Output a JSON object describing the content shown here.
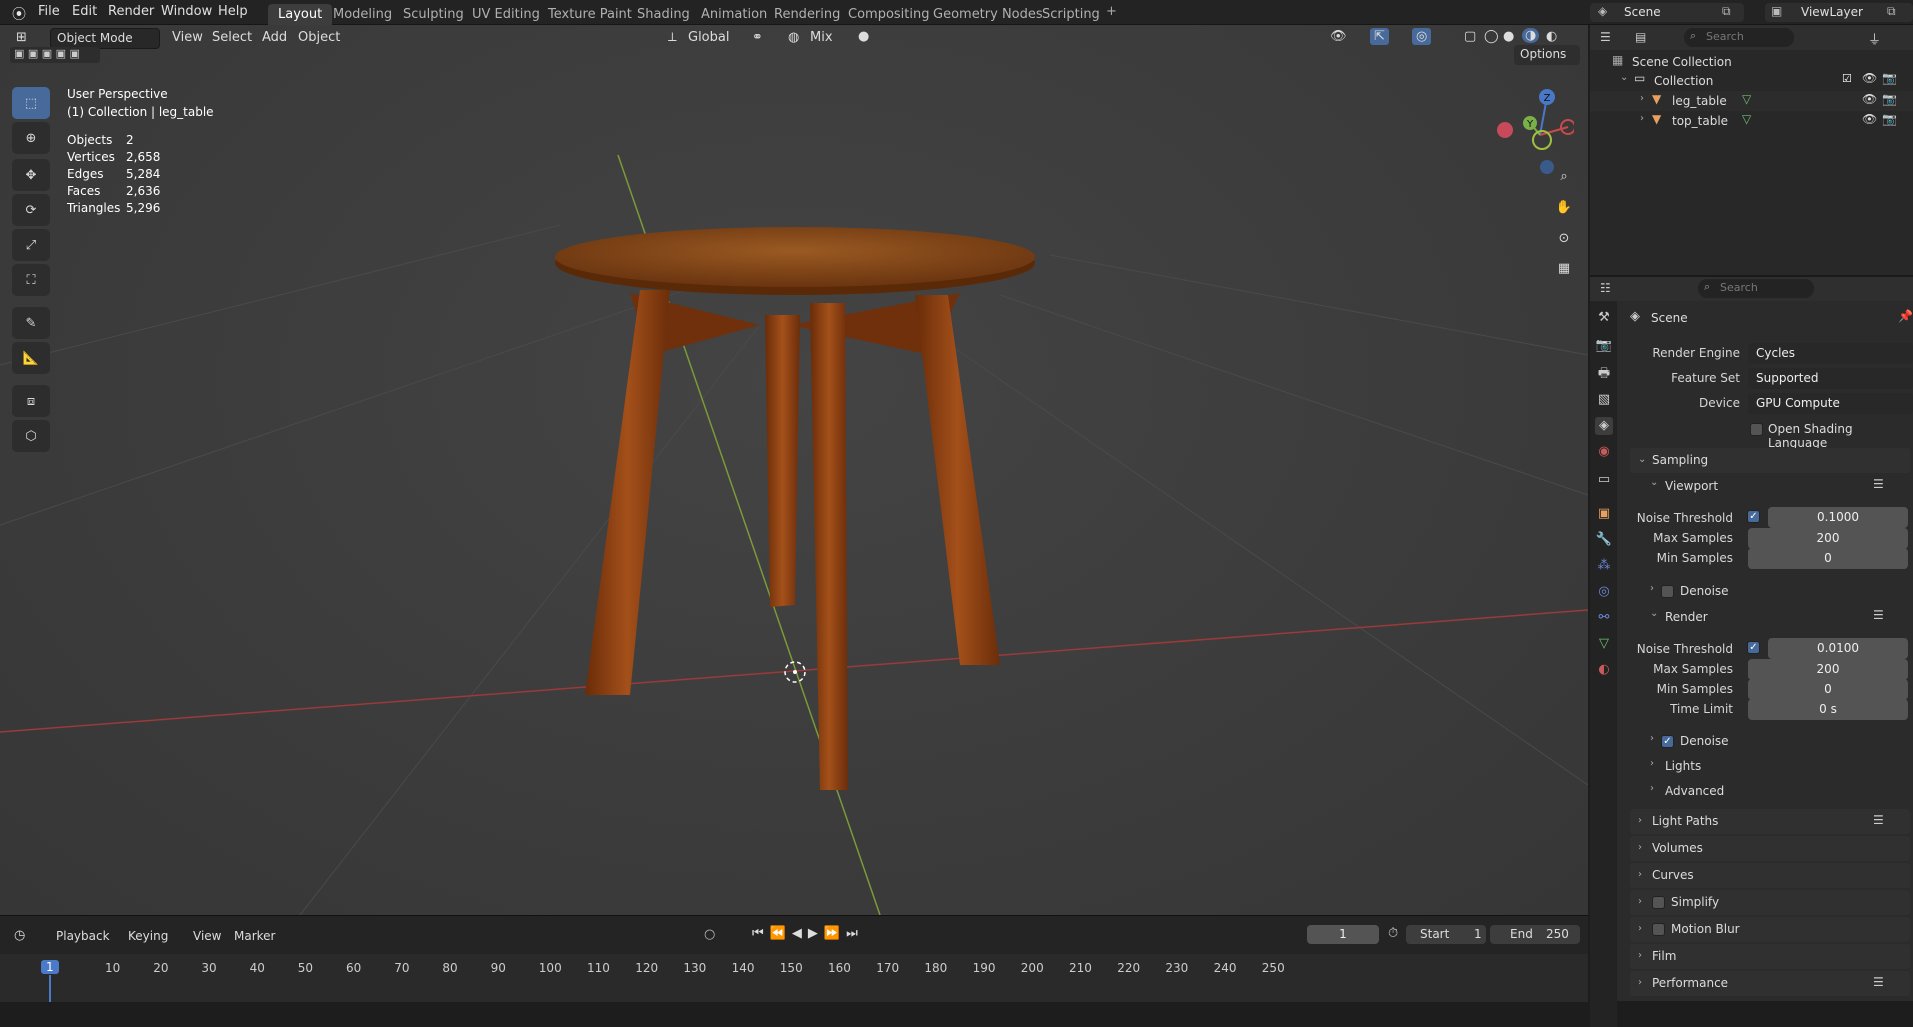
{
  "topbar": {
    "menus": [
      "File",
      "Edit",
      "Render",
      "Window",
      "Help"
    ],
    "workspaces": [
      "Layout",
      "Modeling",
      "Sculpting",
      "UV Editing",
      "Texture Paint",
      "Shading",
      "Animation",
      "Rendering",
      "Compositing",
      "Geometry Nodes",
      "Scripting"
    ],
    "add_tab": "+",
    "scene": "Scene",
    "view_layer": "ViewLayer"
  },
  "viewport_header": {
    "mode": "Object Mode",
    "menus": [
      "View",
      "Select",
      "Add",
      "Object"
    ],
    "orientation": "Global",
    "blend": "Mix",
    "options": "Options"
  },
  "overlay": {
    "title": "User Perspective",
    "subtitle": "(1) Collection | leg_table",
    "stats": [
      {
        "label": "Objects",
        "value": "2"
      },
      {
        "label": "Vertices",
        "value": "2,658"
      },
      {
        "label": "Edges",
        "value": "5,284"
      },
      {
        "label": "Faces",
        "value": "2,636"
      },
      {
        "label": "Triangles",
        "value": "5,296"
      }
    ]
  },
  "gizmo": {
    "z": "Z",
    "y": "Y"
  },
  "outliner": {
    "search_placeholder": "Search",
    "root": "Scene Collection",
    "collection": "Collection",
    "objects": [
      "leg_table",
      "top_table"
    ]
  },
  "properties": {
    "search_placeholder": "Search",
    "context": "Scene",
    "render_engine_label": "Render Engine",
    "render_engine": "Cycles",
    "feature_set_label": "Feature Set",
    "feature_set": "Supported",
    "device_label": "Device",
    "device": "GPU Compute",
    "osl": "Open Shading Language",
    "sampling": "Sampling",
    "viewport": {
      "title": "Viewport",
      "noise_label": "Noise Threshold",
      "noise": "0.1000",
      "max_label": "Max Samples",
      "max": "200",
      "min_label": "Min Samples",
      "min": "0",
      "denoise": "Denoise"
    },
    "render": {
      "title": "Render",
      "noise_label": "Noise Threshold",
      "noise": "0.0100",
      "max_label": "Max Samples",
      "max": "200",
      "min_label": "Min Samples",
      "min": "0",
      "time_label": "Time Limit",
      "time": "0 s",
      "denoise": "Denoise"
    },
    "sub_panels": [
      "Lights",
      "Advanced"
    ],
    "panels": [
      "Light Paths",
      "Volumes",
      "Curves",
      "Simplify",
      "Motion Blur",
      "Film",
      "Performance"
    ]
  },
  "timeline": {
    "menus": [
      "Playback",
      "Keying",
      "View",
      "Marker"
    ],
    "current": "1",
    "start_label": "Start",
    "start": "1",
    "end_label": "End",
    "end": "250",
    "ticks": [
      "1",
      "10",
      "20",
      "30",
      "40",
      "50",
      "60",
      "70",
      "80",
      "90",
      "100",
      "110",
      "120",
      "130",
      "140",
      "150",
      "160",
      "170",
      "180",
      "190",
      "200",
      "210",
      "220",
      "230",
      "240",
      "250"
    ]
  }
}
